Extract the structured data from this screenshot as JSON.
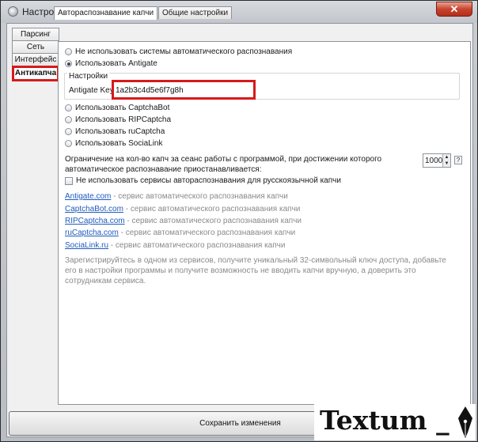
{
  "window": {
    "title": "Настройки",
    "close_label": "✕"
  },
  "side_tabs": [
    {
      "label": "Парсинг"
    },
    {
      "label": "Сеть"
    },
    {
      "label": "Интерфейс"
    },
    {
      "label": "Антикапча"
    }
  ],
  "top_tabs": [
    {
      "label": "Автораспознавание капчи"
    },
    {
      "label": "Общие настройки"
    }
  ],
  "options": {
    "none": "Не использовать системы автоматического распознавания",
    "antigate": "Использовать Antigate",
    "captchabot": "Использовать CaptchaBot",
    "ripcaptcha": "Использовать RIPCaptcha",
    "rucaptcha": "Использовать ruCaptcha",
    "socialink": "Использовать SociaLink"
  },
  "settings_group": {
    "label": "Настройки",
    "key_label": "Antigate Key:",
    "key_value": "1a2b3c4d5e6f7g8h"
  },
  "limit": {
    "text": "Ограничение на кол-во капч за сеанс работы с программой, при достижении которого автоматическое распознавание приостанавливается:",
    "value": "1000",
    "help": "?"
  },
  "russian_checkbox": "Не использовать сервисы автораспознавания для русскоязычной капчи",
  "links": [
    {
      "link": "Antigate.com",
      "desc": " - сервис автоматического распознавания капчи"
    },
    {
      "link": "CaptchaBot.com",
      "desc": " - сервис автоматического распознавания капчи"
    },
    {
      "link": "RIPCaptcha.com",
      "desc": " - сервис автоматического распознавания капчи"
    },
    {
      "link": "ruCaptcha.com",
      "desc": " - сервис автоматического распознавания капчи"
    },
    {
      "link": "SociaLink.ru",
      "desc": " - сервис автоматического распознавания капчи"
    }
  ],
  "footnote": "Зарегистрируйтесь в одном из сервисов, получите уникальный 32-символьный ключ доступа, добавьте его в настройки программы и получите возможность не вводить капчи вручную, а доверить это сотрудникам сервиса.",
  "save_label": "Сохранить изменения",
  "watermark": "Textum _"
}
